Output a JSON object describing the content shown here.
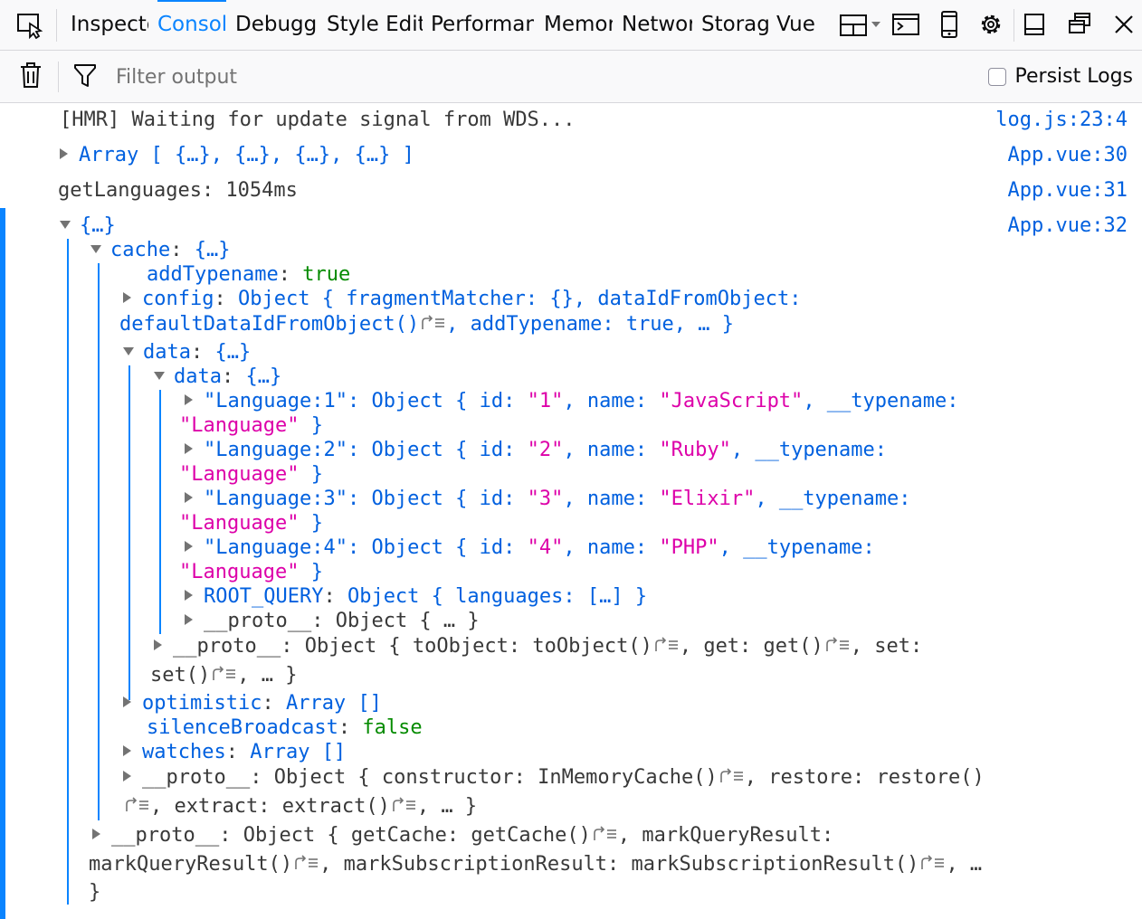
{
  "toolbar": {
    "tabs": [
      "Inspector",
      "Console",
      "Debugger",
      "Style Editor",
      "Performance",
      "Memory",
      "Network",
      "Storage",
      "Vue"
    ],
    "selected_tab": "Console"
  },
  "filterbar": {
    "placeholder": "Filter output",
    "persist_logs_label": "Persist Logs"
  },
  "console": {
    "messages": [
      {
        "text": "[HMR] Waiting for update signal from WDS...",
        "location": "log.js:23:4"
      },
      {
        "text": "Array [ {…}, {…}, {…}, {…} ]",
        "location": "App.vue:30"
      },
      {
        "text": "getLanguages: 1054ms",
        "location": "App.vue:31"
      },
      {
        "text": "{…}",
        "location": "App.vue:32"
      }
    ],
    "tree": {
      "root": "{…}",
      "cache_key": "cache",
      "cache_preview": "{…}",
      "addTypename_key": "addTypename",
      "addTypename_value": "true",
      "config_key": "config",
      "config_line1": "Object { fragmentMatcher: {}, dataIdFromObject:",
      "config_line2a": "defaultDataIdFromObject()",
      "config_line2b": ", addTypename: true, … }",
      "data_key": "data",
      "data_preview": "{…}",
      "inner_data_key": "data",
      "inner_data_preview": "{…}",
      "languages": [
        {
          "key": "\"Language:1\"",
          "id": "\"1\"",
          "name": "\"JavaScript\"",
          "typename": "\"Language\""
        },
        {
          "key": "\"Language:2\"",
          "id": "\"2\"",
          "name": "\"Ruby\"",
          "typename": "\"Language\""
        },
        {
          "key": "\"Language:3\"",
          "id": "\"3\"",
          "name": "\"Elixir\"",
          "typename": "\"Language\""
        },
        {
          "key": "\"Language:4\"",
          "id": "\"4\"",
          "name": "\"PHP\"",
          "typename": "\"Language\""
        }
      ],
      "root_query_key": "ROOT_QUERY",
      "root_query_value": "Object { languages: […] }",
      "proto_key": "__proto__",
      "proto_short": "Object { … }",
      "data_proto_line1": "Object { toObject: toObject()",
      "data_proto_line1b": ", get: get()",
      "data_proto_line1c": ", set:",
      "data_proto_line2a": "set()",
      "data_proto_line2b": ", … }",
      "optimistic_key": "optimistic",
      "optimistic_value": "Array []",
      "silence_key": "silenceBroadcast",
      "silence_value": "false",
      "watches_key": "watches",
      "watches_value": "Array []",
      "cache_proto_line1a": "Object { constructor: InMemoryCache()",
      "cache_proto_line1b": ", restore: restore()",
      "cache_proto_line2": ", extract: extract()",
      "cache_proto_line2b": ", … }",
      "root_proto_line1a": "Object { getCache: getCache()",
      "root_proto_line1b": ", markQueryResult:",
      "root_proto_line2a": "markQueryResult()",
      "root_proto_line2b": ", markSubscriptionResult: markSubscriptionResult()",
      "root_proto_line2c": ", …",
      "root_proto_line3": "}"
    }
  }
}
